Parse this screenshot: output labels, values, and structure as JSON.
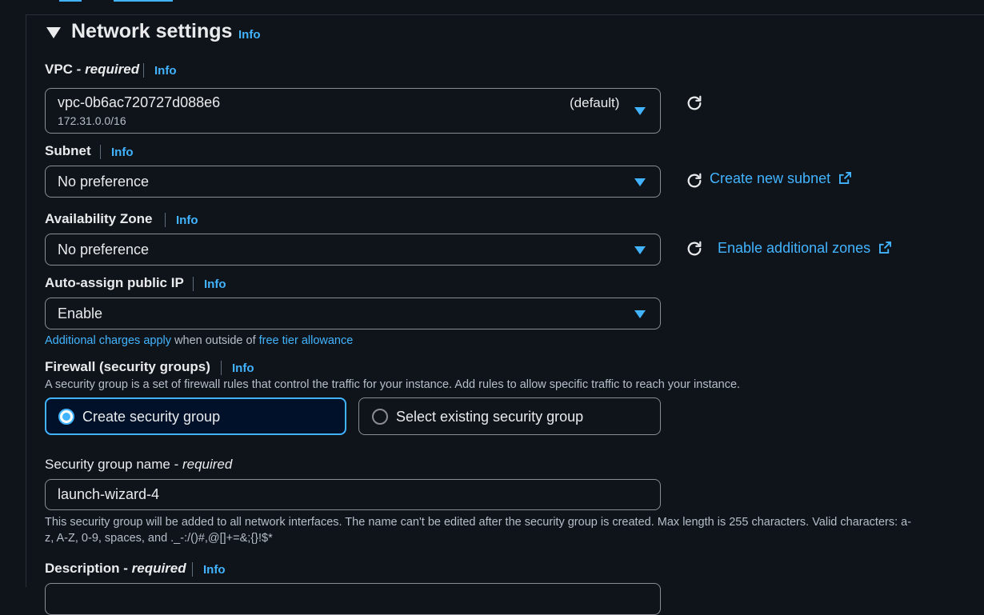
{
  "network_settings": {
    "title": "Network settings",
    "info": "Info"
  },
  "vpc": {
    "label": "VPC - ",
    "required": "required",
    "info": "Info",
    "value": "vpc-0b6ac720727d088e6",
    "cidr": "172.31.0.0/16",
    "tag": "(default)"
  },
  "subnet": {
    "label": "Subnet",
    "info": "Info",
    "value": "No preference",
    "create_link": "Create new subnet"
  },
  "availability_zone": {
    "label": "Availability Zone",
    "info": "Info",
    "value": "No preference",
    "enable_link": "Enable additional zones"
  },
  "public_ip": {
    "label": "Auto-assign public IP",
    "info": "Info",
    "value": "Enable",
    "note_link1": "Additional charges apply",
    "note_text": " when outside of ",
    "note_link2": "free tier allowance"
  },
  "firewall": {
    "label": "Firewall (security groups)",
    "info": "Info",
    "description": "A security group is a set of firewall rules that control the traffic for your instance. Add rules to allow specific traffic to reach your instance.",
    "option_create": "Create security group",
    "option_existing": "Select existing security group"
  },
  "sg_name": {
    "label": "Security group name - ",
    "required": "required",
    "value": "launch-wizard-4",
    "help_line1": "This security group will be added to all network interfaces. The name can't be edited after the security group is created. Max length is 255 characters. Valid characters: a-",
    "help_line2": "z, A-Z, 0-9, spaces, and ._-:/()#,@[]+=&;{}!$*"
  },
  "description": {
    "label": "Description - ",
    "required": "required",
    "info": "Info"
  },
  "colors": {
    "background": "#0f141a",
    "accent": "#42b4ff",
    "selected_tile": "#001129",
    "border": "#8c8c94",
    "text": "#e9ebed",
    "muted": "#b6bec9"
  }
}
